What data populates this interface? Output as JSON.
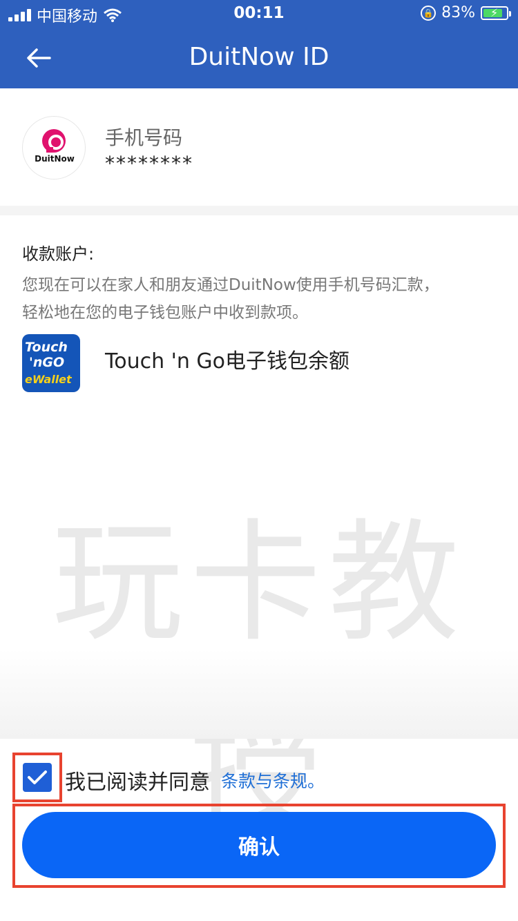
{
  "status_bar": {
    "carrier": "中国移动",
    "time": "00:11",
    "battery": "83%",
    "battery_level": 83
  },
  "header": {
    "title": "DuitNow ID"
  },
  "id_card": {
    "logo_text": "DuitNow",
    "label": "手机号码",
    "value": "********"
  },
  "account": {
    "title": "收款账户:",
    "desc_line1": "您现在可以在家人和朋友通过DuitNow使用手机号码汇款，",
    "desc_line2": "轻松地在您的电子钱包账户中收到款项。",
    "wallet": {
      "logo_line1": "Touch",
      "logo_line2": "'nGO",
      "logo_line3": "eWallet",
      "name": "Touch 'n Go电子钱包余额"
    }
  },
  "watermark": "玩卡教授",
  "agreement": {
    "checked": true,
    "text": "我已阅读并同意",
    "terms_link": "条款与条规。"
  },
  "confirm": {
    "label": "确认"
  },
  "colors": {
    "header_blue": "#2e60be",
    "primary_button": "#0a66f6",
    "highlight_red": "#e8432f",
    "link_blue": "#1f6fd6"
  }
}
